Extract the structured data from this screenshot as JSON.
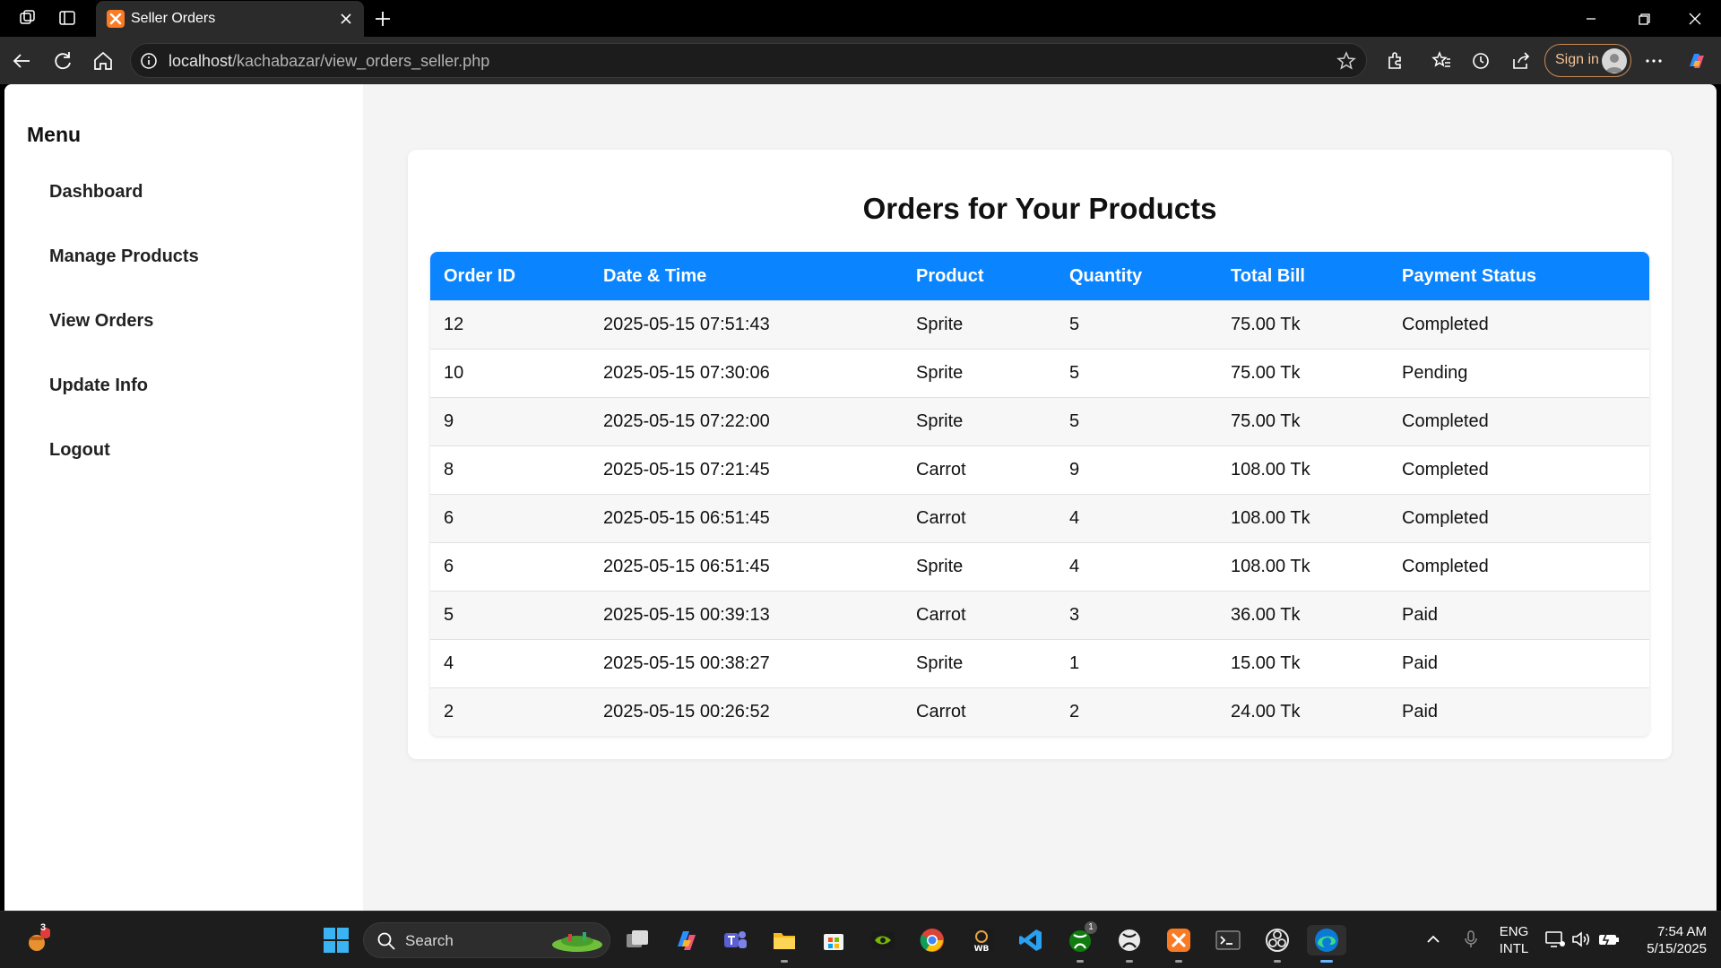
{
  "browser": {
    "tab_title": "Seller Orders",
    "url_host": "localhost",
    "url_path": "/kachabazar/view_orders_seller.php",
    "sign_in_label": "Sign in",
    "accent": "#0a84ff"
  },
  "sidebar": {
    "title": "Menu",
    "items": [
      {
        "label": "Dashboard"
      },
      {
        "label": "Manage Products"
      },
      {
        "label": "View Orders"
      },
      {
        "label": "Update Info"
      },
      {
        "label": "Logout"
      }
    ]
  },
  "main": {
    "title": "Orders for Your Products",
    "columns": [
      "Order ID",
      "Date & Time",
      "Product",
      "Quantity",
      "Total Bill",
      "Payment Status"
    ],
    "rows": [
      [
        "12",
        "2025-05-15 07:51:43",
        "Sprite",
        "5",
        "75.00 Tk",
        "Completed"
      ],
      [
        "10",
        "2025-05-15 07:30:06",
        "Sprite",
        "5",
        "75.00 Tk",
        "Pending"
      ],
      [
        "9",
        "2025-05-15 07:22:00",
        "Sprite",
        "5",
        "75.00 Tk",
        "Completed"
      ],
      [
        "8",
        "2025-05-15 07:21:45",
        "Carrot",
        "9",
        "108.00 Tk",
        "Completed"
      ],
      [
        "6",
        "2025-05-15 06:51:45",
        "Carrot",
        "4",
        "108.00 Tk",
        "Completed"
      ],
      [
        "6",
        "2025-05-15 06:51:45",
        "Sprite",
        "4",
        "108.00 Tk",
        "Completed"
      ],
      [
        "5",
        "2025-05-15 00:39:13",
        "Carrot",
        "3",
        "36.00 Tk",
        "Paid"
      ],
      [
        "4",
        "2025-05-15 00:38:27",
        "Sprite",
        "1",
        "15.00 Tk",
        "Paid"
      ],
      [
        "2",
        "2025-05-15 00:26:52",
        "Carrot",
        "2",
        "24.00 Tk",
        "Paid"
      ]
    ]
  },
  "taskbar": {
    "search_label": "Search",
    "notification_badge": "3",
    "xbox_badge": "1",
    "lang_line1": "ENG",
    "lang_line2": "INTL",
    "time": "7:54 AM",
    "date": "5/15/2025",
    "icons": [
      "weather-icon",
      "start-icon",
      "search-icon",
      "task-view-icon",
      "copilot-icon",
      "teams-icon",
      "file-explorer-icon",
      "store-icon",
      "nvidia-icon",
      "chrome-icon",
      "wb-icon",
      "vscode-icon",
      "xbox-game-bar-icon",
      "xbox-icon",
      "xampp-icon",
      "terminal-icon",
      "obs-icon",
      "edge-icon"
    ]
  }
}
